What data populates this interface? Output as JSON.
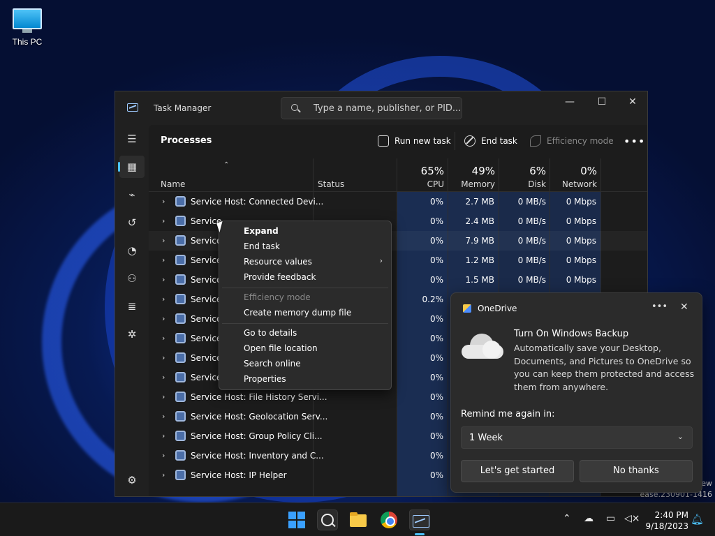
{
  "desktop": {
    "this_pc_label": "This PC"
  },
  "task_manager": {
    "title": "Task Manager",
    "search_placeholder": "Type a name, publisher, or PID...",
    "window_controls": {
      "minimize": "—",
      "maximize": "☐",
      "close": "✕"
    },
    "page_title": "Processes",
    "toolbar": {
      "run_new_task": "Run new task",
      "end_task": "End task",
      "efficiency_mode": "Efficiency mode",
      "more": "•••"
    },
    "columns": {
      "name": "Name",
      "status": "Status",
      "cpu": {
        "pct": "65%",
        "label": "CPU"
      },
      "memory": {
        "pct": "49%",
        "label": "Memory"
      },
      "disk": {
        "pct": "6%",
        "label": "Disk"
      },
      "network": {
        "pct": "0%",
        "label": "Network"
      }
    },
    "rows": [
      {
        "name": "Service Host: Connected Devi...",
        "cpu": "0%",
        "mem": "2.7 MB",
        "disk": "0 MB/s",
        "net": "0 Mbps"
      },
      {
        "name": "Service",
        "cpu": "0%",
        "mem": "2.4 MB",
        "disk": "0 MB/s",
        "net": "0 Mbps"
      },
      {
        "name": "Service",
        "cpu": "0%",
        "mem": "7.9 MB",
        "disk": "0 MB/s",
        "net": "0 Mbps"
      },
      {
        "name": "Service",
        "cpu": "0%",
        "mem": "1.2 MB",
        "disk": "0 MB/s",
        "net": "0 Mbps"
      },
      {
        "name": "Service",
        "cpu": "0%",
        "mem": "1.5 MB",
        "disk": "0 MB/s",
        "net": "0 Mbps"
      },
      {
        "name": "Service",
        "cpu": "0.2%",
        "mem": "",
        "disk": "",
        "net": ""
      },
      {
        "name": "Service",
        "cpu": "0%",
        "mem": "",
        "disk": "",
        "net": ""
      },
      {
        "name": "Service",
        "cpu": "0%",
        "mem": "",
        "disk": "",
        "net": ""
      },
      {
        "name": "Service",
        "cpu": "0%",
        "mem": "",
        "disk": "",
        "net": ""
      },
      {
        "name": "Service",
        "cpu": "0%",
        "mem": "",
        "disk": "",
        "net": ""
      },
      {
        "name": "Service Host: File History Servi...",
        "cpu": "0%",
        "mem": "",
        "disk": "",
        "net": ""
      },
      {
        "name": "Service Host: Geolocation Serv...",
        "cpu": "0%",
        "mem": "",
        "disk": "",
        "net": ""
      },
      {
        "name": "Service Host: Group Policy Cli...",
        "cpu": "0%",
        "mem": "",
        "disk": "",
        "net": ""
      },
      {
        "name": "Service Host: Inventory and C...",
        "cpu": "0%",
        "mem": "",
        "disk": "",
        "net": ""
      },
      {
        "name": "Service Host: IP Helper",
        "cpu": "0%",
        "mem": "",
        "disk": "",
        "net": ""
      }
    ]
  },
  "context_menu": {
    "expand": "Expand",
    "end_task": "End task",
    "resource_values": "Resource values",
    "provide_feedback": "Provide feedback",
    "efficiency_mode": "Efficiency mode",
    "create_dump": "Create memory dump file",
    "go_to_details": "Go to details",
    "open_file_location": "Open file location",
    "search_online": "Search online",
    "properties": "Properties"
  },
  "onedrive_toast": {
    "app": "OneDrive",
    "more": "•••",
    "close": "✕",
    "heading": "Turn On Windows Backup",
    "body": "Automatically save your Desktop, Documents, and Pictures to OneDrive so you can keep them protected and access them from anywhere.",
    "remind_label": "Remind me again in:",
    "remind_value": "1 Week",
    "primary_button": "Let's get started",
    "secondary_button": "No thanks"
  },
  "watermark": {
    "line1": "ew",
    "line2": "ease.230901-1416"
  },
  "taskbar": {
    "time": "2:40 PM",
    "date": "9/18/2023"
  },
  "colors": {
    "accent": "#4cc2ff",
    "heat_blue": "#1a2a4a"
  }
}
